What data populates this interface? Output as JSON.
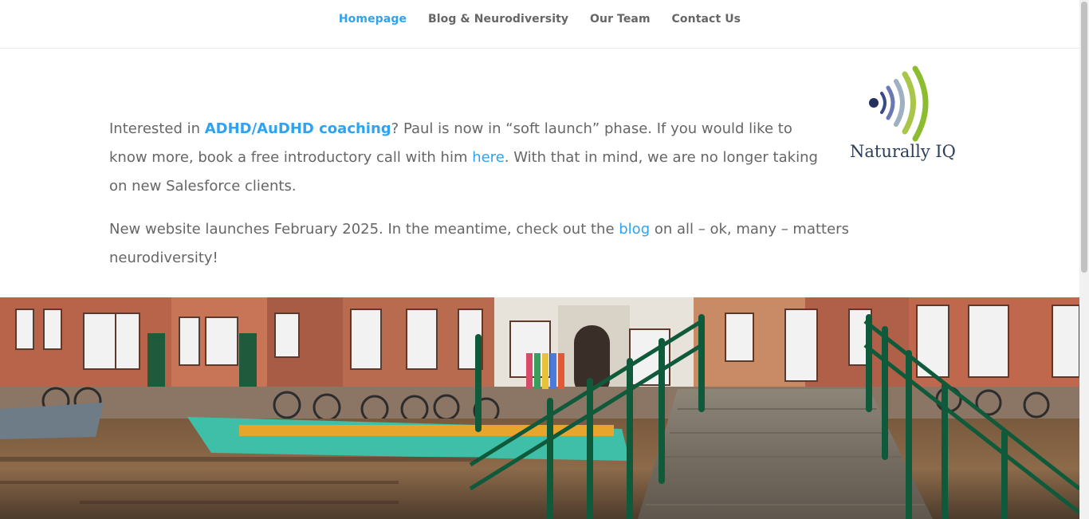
{
  "nav": {
    "items": [
      {
        "label": "Homepage",
        "active": true
      },
      {
        "label": "Blog & Neurodiversity",
        "active": false
      },
      {
        "label": "Our Team",
        "active": false
      },
      {
        "label": "Contact Us",
        "active": false
      }
    ]
  },
  "intro": {
    "p1_pre": "Interested in ",
    "p1_link": "ADHD/AuDHD coaching",
    "p1_mid": "? Paul is now in “soft launch” phase. If you would like to know more, book a free introductory call with him ",
    "p1_link2": "here",
    "p1_post": ". With that in mind, we are no longer taking on new Salesforce clients.",
    "p2_pre": "New website launches February 2025. In the meantime, check out the ",
    "p2_link": "blog",
    "p2_post": " on all – ok, many – matters neurodiversity!"
  },
  "logo": {
    "text": "Naturally IQ",
    "icon": "sound-waves-logo-icon"
  },
  "hero": {
    "icon": "amsterdam-canal-bridge-photo"
  },
  "colors": {
    "link": "#2ea3f2",
    "body_text": "#666666",
    "nav_text": "#666666"
  }
}
